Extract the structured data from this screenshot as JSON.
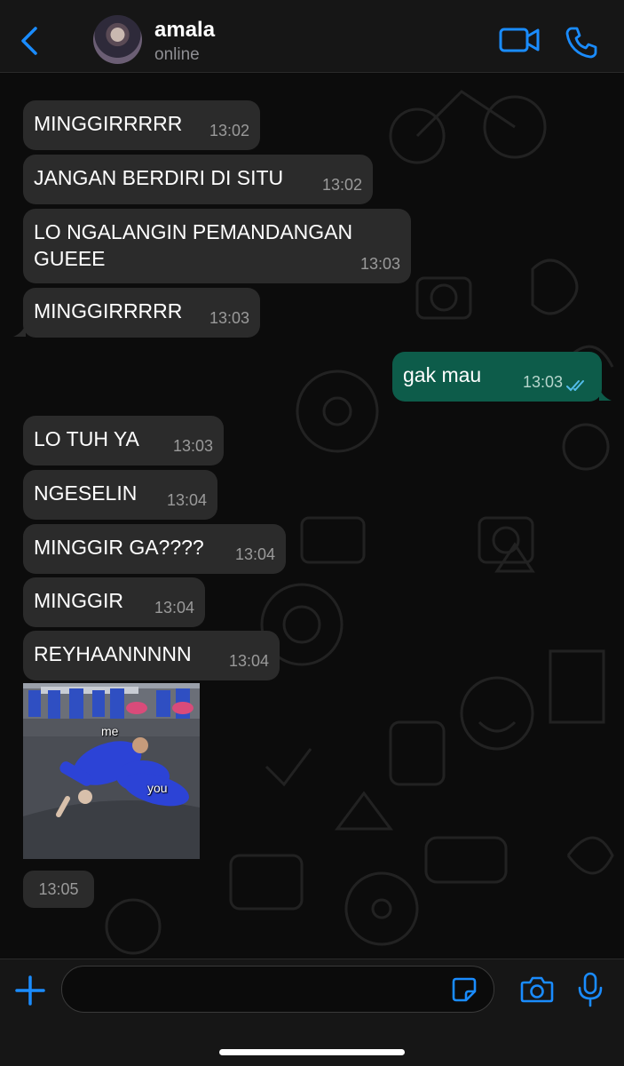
{
  "header": {
    "contact_name": "amala",
    "status": "online"
  },
  "messages": [
    {
      "text": "MINGGIRRRRR",
      "time": "13:02",
      "direction": "in"
    },
    {
      "text": "JANGAN BERDIRI DI SITU",
      "time": "13:02",
      "direction": "in"
    },
    {
      "text": "LO NGALANGIN PEMANDANGAN GUEEE",
      "time": "13:03",
      "direction": "in"
    },
    {
      "text": "MINGGIRRRRR",
      "time": "13:03",
      "direction": "in"
    },
    {
      "text": "gak mau",
      "time": "13:03",
      "direction": "out",
      "read": true
    },
    {
      "text": "LO TUH YA",
      "time": "13:03",
      "direction": "in"
    },
    {
      "text": "NGESELIN",
      "time": "13:04",
      "direction": "in"
    },
    {
      "text": "MINGGIR GA????",
      "time": "13:04",
      "direction": "in"
    },
    {
      "text": "MINGGIR",
      "time": "13:04",
      "direction": "in"
    },
    {
      "text": "REYHAANNNNN",
      "time": "13:04",
      "direction": "in"
    }
  ],
  "media_message": {
    "label_top": "me",
    "label_bottom": "you",
    "time": "13:05"
  },
  "composer": {
    "placeholder": ""
  },
  "colors": {
    "accent": "#1a8cff",
    "incoming_bubble": "#2b2b2b",
    "outgoing_bubble": "#0d5c4a",
    "read_tick": "#53bdeb"
  },
  "icons": [
    "chevron-left-icon",
    "video-camera-icon",
    "phone-icon",
    "plus-icon",
    "sticker-icon",
    "camera-icon",
    "microphone-icon",
    "double-check-icon"
  ]
}
